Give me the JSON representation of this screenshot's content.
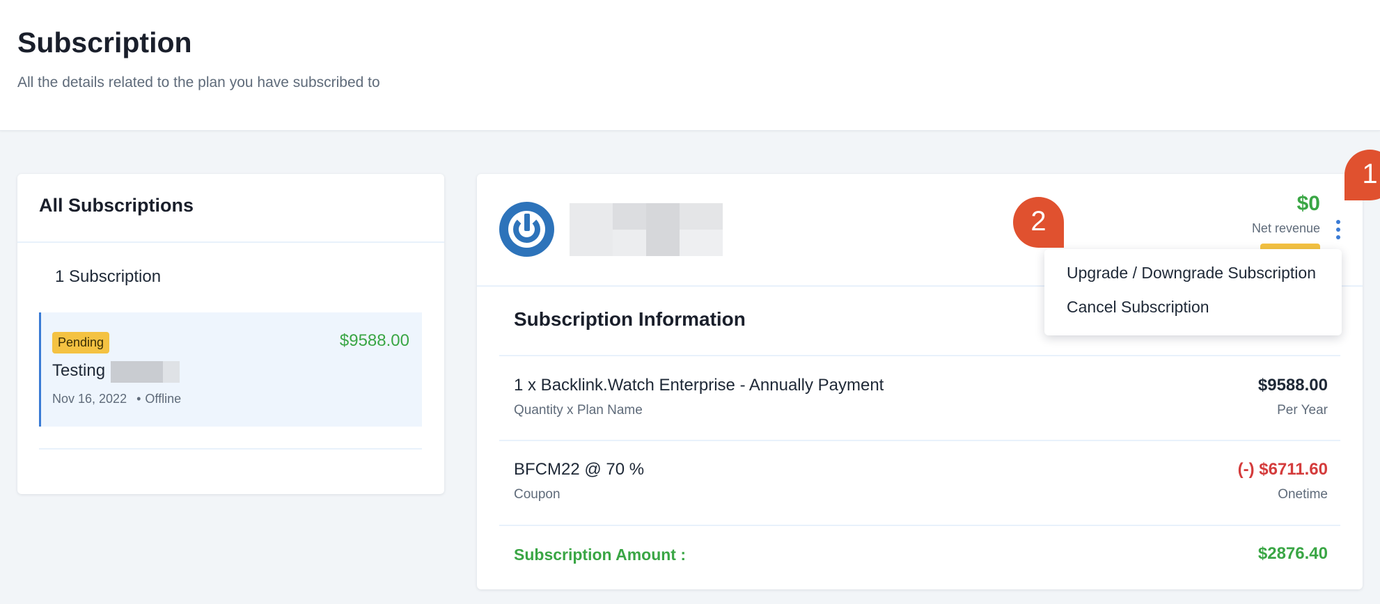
{
  "header": {
    "title": "Subscription",
    "subtitle": "All the details related to the plan you have subscribed to"
  },
  "left_panel": {
    "title": "All Subscriptions",
    "count_label": "1 Subscription",
    "items": [
      {
        "status": "Pending",
        "amount": "$9588.00",
        "name": "Testing",
        "date": "Nov 16, 2022",
        "mode": "Offline"
      }
    ]
  },
  "detail": {
    "net_amount": "$0",
    "net_label": "Net revenue",
    "section_title": "Subscription Information",
    "rows": [
      {
        "main": "1 x Backlink.Watch Enterprise - Annually Payment",
        "sub": "Quantity x Plan Name",
        "value": "$9588.00",
        "value_sub": "Per Year"
      },
      {
        "main": "BFCM22 @ 70 %",
        "sub": "Coupon",
        "value": "(-) $6711.60",
        "value_sub": "Onetime"
      }
    ],
    "total_label": "Subscription Amount :",
    "total_value": "$2876.40"
  },
  "menu": {
    "items": [
      "Upgrade / Downgrade Subscription",
      "Cancel Subscription"
    ]
  },
  "markers": {
    "first": "1",
    "second": "2"
  },
  "colors": {
    "accent": "#3a7bd5",
    "positive": "#3aa645",
    "negative": "#d43c3c",
    "pending": "#f4c242",
    "marker": "#e0512f"
  }
}
